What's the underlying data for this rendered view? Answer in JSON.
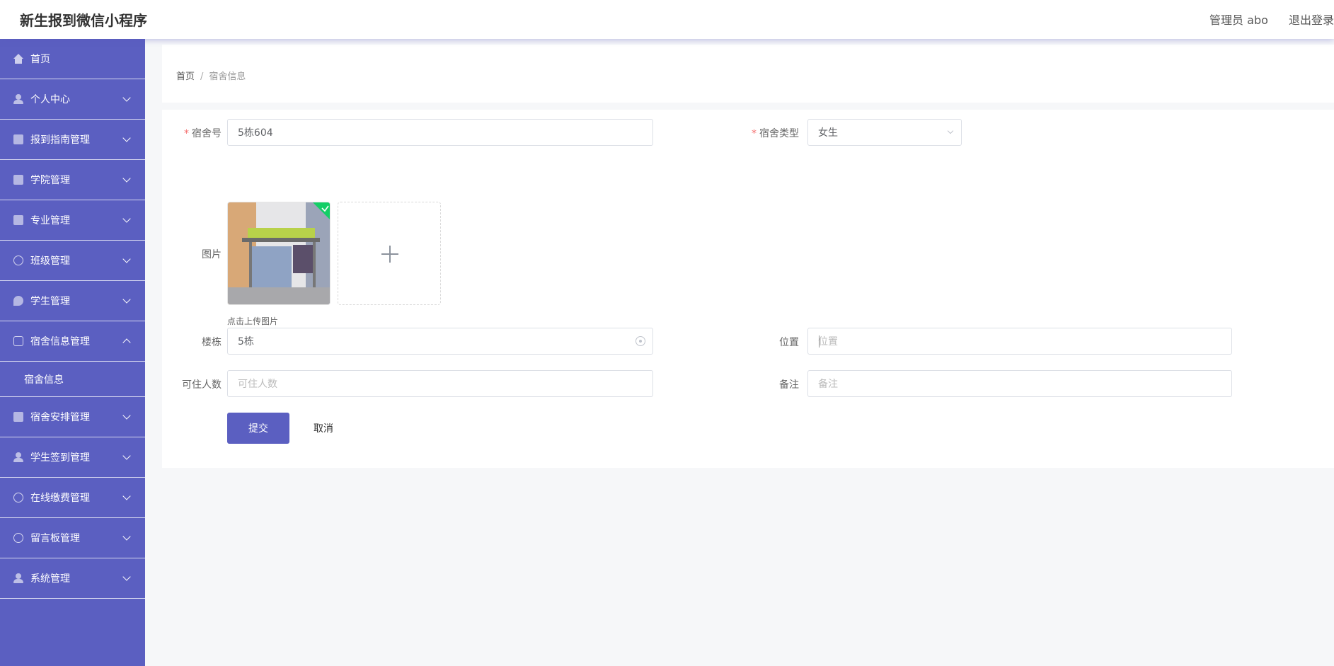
{
  "header": {
    "title": "新生报到微信小程序",
    "user_label": "管理员 abo",
    "logout_label": "退出登录"
  },
  "sidebar": {
    "items": [
      {
        "label": "首页",
        "icon": "home-icon"
      },
      {
        "label": "个人中心",
        "icon": "person-icon"
      },
      {
        "label": "报到指南管理",
        "icon": "briefcase-icon"
      },
      {
        "label": "学院管理",
        "icon": "school-icon"
      },
      {
        "label": "专业管理",
        "icon": "clipboard-icon"
      },
      {
        "label": "班级管理",
        "icon": "clock-icon"
      },
      {
        "label": "学生管理",
        "icon": "location-icon"
      },
      {
        "label": "宿舍信息管理",
        "icon": "chat-icon"
      },
      {
        "label": "宿舍安排管理",
        "icon": "ticket-icon"
      },
      {
        "label": "学生签到管理",
        "icon": "user-icon"
      },
      {
        "label": "在线缴费管理",
        "icon": "compass-icon"
      },
      {
        "label": "留言板管理",
        "icon": "lifebuoy-icon"
      },
      {
        "label": "系统管理",
        "icon": "person-icon"
      }
    ],
    "submenu_label": "宿舍信息"
  },
  "breadcrumb": {
    "home": "首页",
    "separator": "/",
    "current": "宿舍信息"
  },
  "form": {
    "dorm_no": {
      "label": "宿舍号",
      "value": "5栋604"
    },
    "dorm_type": {
      "label": "宿舍类型",
      "value": "女生"
    },
    "image": {
      "label": "图片",
      "hint": "点击上传图片"
    },
    "building": {
      "label": "楼栋",
      "value": "5栋"
    },
    "location": {
      "label": "位置",
      "placeholder": "位置"
    },
    "capacity": {
      "label": "可住人数",
      "placeholder": "可住人数"
    },
    "remark": {
      "label": "备注",
      "placeholder": "备注"
    },
    "submit_label": "提交",
    "cancel_label": "取消"
  },
  "colors": {
    "accent": "#5b5fc1",
    "success": "#13ce66",
    "required": "#f56c6c"
  }
}
